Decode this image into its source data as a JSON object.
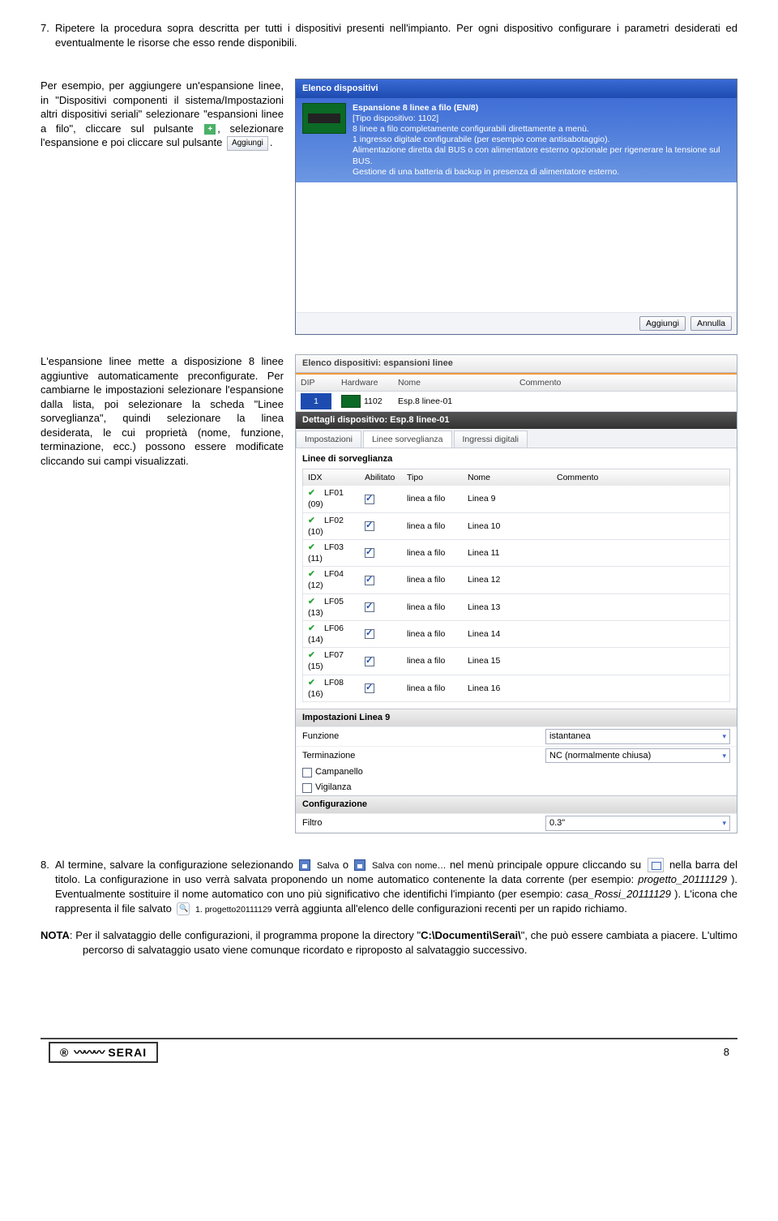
{
  "ol7": {
    "num": "7.",
    "text": "Ripetere la procedura sopra descritta per tutti i dispositivi presenti nell'impianto. Per ogni dispositivo configurare i parametri desiderati ed eventualmente le risorse che esso rende disponibili."
  },
  "leftA": {
    "p1a": "Per esempio, per aggiungere un'espansione linee, in \"Dispositivi componenti il sistema/Impostazioni altri dispositivi seriali\" selezionare \"espansioni linee a filo\", cliccare sul pulsante ",
    "p1b": ", selezionare l'espansione e poi cliccare sul pulsante ",
    "p1c": "."
  },
  "win1": {
    "title": "Elenco dispositivi",
    "headline": "Espansione 8 linee a filo (EN/8)",
    "tipo": "[Tipo dispositivo: 1102]",
    "d1": "8 linee a filo completamente configurabili direttamente a menù.",
    "d2": "1 ingresso digitale configurabile (per esempio come antisabotaggio).",
    "d3": "Alimentazione diretta dal BUS o con alimentatore esterno opzionale per rigenerare la tensione sul BUS.",
    "d4": "Gestione di una batteria di backup in presenza di alimentatore esterno.",
    "btn_add": "Aggiungi",
    "btn_cancel": "Annulla"
  },
  "leftB": {
    "p2": "L'espansione linee mette a disposizione 8 linee aggiuntive automaticamente preconfigurate. Per cambiarne le impostazioni selezionare l'espansione dalla lista, poi selezionare la scheda \"Linee sorveglianza\", quindi selezionare la linea desiderata, le cui proprietà (nome, funzione, terminazione, ecc.) possono essere modificate cliccando sui campi visualizzati."
  },
  "win2": {
    "head": "Elenco dispositivi: espansioni linee",
    "cols": {
      "dip": "DIP",
      "hw": "Hardware",
      "nome": "Nome",
      "com": "Commento"
    },
    "row": {
      "dip": "1",
      "hw": "1102",
      "nome": "Esp.8 linee-01"
    },
    "dett": "Dettagli dispositivo: Esp.8 linee-01",
    "tabs": {
      "imp": "Impostazioni",
      "linee": "Linee sorveglianza",
      "ing": "Ingressi digitali"
    },
    "subtitle": "Linee di sorveglianza",
    "scols": {
      "idx": "IDX",
      "ab": "Abilitato",
      "tipo": "Tipo",
      "nome": "Nome",
      "com": "Commento"
    },
    "rows": [
      {
        "idx": "LF01 (09)",
        "tipo": "linea a filo",
        "nome": "Linea 9"
      },
      {
        "idx": "LF02 (10)",
        "tipo": "linea a filo",
        "nome": "Linea 10"
      },
      {
        "idx": "LF03 (11)",
        "tipo": "linea a filo",
        "nome": "Linea 11"
      },
      {
        "idx": "LF04 (12)",
        "tipo": "linea a filo",
        "nome": "Linea 12"
      },
      {
        "idx": "LF05 (13)",
        "tipo": "linea a filo",
        "nome": "Linea 13"
      },
      {
        "idx": "LF06 (14)",
        "tipo": "linea a filo",
        "nome": "Linea 14"
      },
      {
        "idx": "LF07 (15)",
        "tipo": "linea a filo",
        "nome": "Linea 15"
      },
      {
        "idx": "LF08 (16)",
        "tipo": "linea a filo",
        "nome": "Linea 16"
      }
    ],
    "impHead": "Impostazioni Linea 9",
    "funz": {
      "label": "Funzione",
      "val": "istantanea"
    },
    "term": {
      "label": "Terminazione",
      "val": "NC (normalmente chiusa)"
    },
    "campanello": "Campanello",
    "vigilanza": "Vigilanza",
    "confHead": "Configurazione",
    "filtro": {
      "label": "Filtro",
      "val": "0.3\""
    }
  },
  "ol8": {
    "num": "8.",
    "a": "Al termine, salvare la configurazione selezionando ",
    "salva": "Salva",
    "b": " o ",
    "salvacon": "Salva con nome…",
    "c": " nel menù principale oppure cliccando su ",
    "d": " nella barra del titolo. La configurazione in uso verrà salvata proponendo un nome automatico contenente la data corrente (per esempio: ",
    "ex1": "progetto_20111129",
    "e": "). Eventualmente sostituire il nome automatico con uno più significativo che identifichi l'impianto (per esempio: ",
    "ex2": "casa_Rossi_20111129",
    "f": "). L'icona che rappresenta il file salvato ",
    "recent": "1. progetto20111129",
    "g": " verrà aggiunta all'elenco delle configurazioni recenti per un rapido richiamo."
  },
  "nota": {
    "prefix": "NOTA",
    "text": ": Per il salvataggio delle configurazioni, il programma propone la directory \"",
    "path": "C:\\Documenti\\Serai\\",
    "text2": "\", che può essere cambiata a piacere. L'ultimo percorso di salvataggio usato viene comunque ricordato e riproposto al salvataggio successivo."
  },
  "icons": {
    "aggiungi_btn": "Aggiungi"
  },
  "page_num": "8",
  "logo": "SERAI"
}
